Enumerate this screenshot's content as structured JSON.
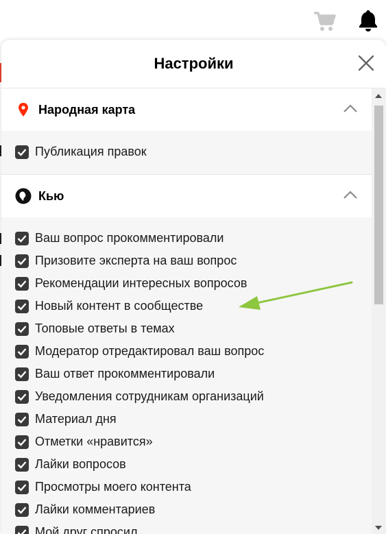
{
  "topbar": {
    "cart_icon": "shopping-cart-icon",
    "bell_icon": "notification-bell-icon"
  },
  "panel": {
    "title": "Настройки",
    "close_icon": "close-icon"
  },
  "sections": [
    {
      "title": "Народная карта",
      "icon": "map-pin-icon",
      "icon_color": "#ff2a00",
      "expanded": true,
      "items": [
        {
          "label": "Публикация правок",
          "checked": true
        }
      ]
    },
    {
      "title": "Кью",
      "icon": "q-logo-icon",
      "expanded": true,
      "items": [
        {
          "label": "Ваш вопрос прокомментировали",
          "checked": true
        },
        {
          "label": "Призовите эксперта на ваш вопрос",
          "checked": true
        },
        {
          "label": "Рекомендации интересных вопросов",
          "checked": true
        },
        {
          "label": "Новый контент в сообществе",
          "checked": true
        },
        {
          "label": "Топовые ответы в темах",
          "checked": true
        },
        {
          "label": "Модератор отредактировал ваш вопрос",
          "checked": true
        },
        {
          "label": "Ваш ответ прокомментировали",
          "checked": true
        },
        {
          "label": "Уведомления сотрудникам организаций",
          "checked": true
        },
        {
          "label": "Материал дня",
          "checked": true
        },
        {
          "label": "Отметки «нравится»",
          "checked": true
        },
        {
          "label": "Лайки вопросов",
          "checked": true
        },
        {
          "label": "Просмотры моего контента",
          "checked": true
        },
        {
          "label": "Лайки комментариев",
          "checked": true
        },
        {
          "label": "Мой друг спросил",
          "checked": true
        }
      ]
    }
  ],
  "annotation": {
    "arrow_color": "#8dc63f",
    "points_to": "Новый контент в сообществе"
  }
}
